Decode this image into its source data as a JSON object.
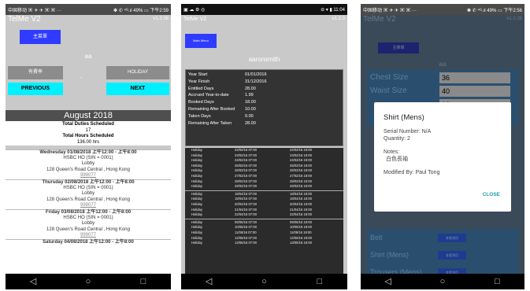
{
  "screen1": {
    "status": {
      "left": "中国移动 ▣ ✈ ✈ ▣ ▣ ···",
      "right": "✽ ✆ ⁴ᴳ.ıl 49% ▭ 下午2:59"
    },
    "app_title": "TelMe V2",
    "version": "v1.3.38",
    "main_menu": "主菜單",
    "username": "aa",
    "paid_button": "有費率",
    "separator": "-",
    "holiday_button": "HOLIDAY",
    "previous_button": "PREVIOUS",
    "next_button": "NEXT",
    "month": "August 2018",
    "total_duties_label": "Total Duties Scheduled",
    "total_duties_value": "17",
    "total_hours_label": "Total Hours Scheduled",
    "total_hours_value": "136.00 hrs",
    "entries": [
      {
        "title": "Wednesday 01/08/2018 上午12:00 - 上午8:00",
        "org": "HSBC HO (SIN = 0001)",
        "place": "Lobby",
        "address": "128 Queen's Road Central , Hong Kong",
        "code": "999077"
      },
      {
        "title": "Thursday 02/08/2018 上午12:00 - 上午8:00",
        "org": "HSBC HO (SIN = 0001)",
        "place": "Lobby",
        "address": "128 Queen's Road Central , Hong Kong",
        "code": "999077"
      },
      {
        "title": "Friday 03/08/2018 上午12:00 - 上午8:00",
        "org": "HSBC HO (SIN = 0001)",
        "place": "Lobby",
        "address": "128 Queen's Road Central , Hong Kong",
        "code": "999077"
      },
      {
        "title": "Saturday 04/08/2018 上午12:00 - 上午8:00",
        "org": "",
        "place": "",
        "address": "",
        "code": ""
      }
    ]
  },
  "screen2": {
    "status": {
      "left": "▣ ☁ ⚙ ◎",
      "right": "⊖ ▾ ▮ 11:04"
    },
    "app_title": "TelMe V2",
    "version": "v1.2.0",
    "main_menu": "Main Menu",
    "username": "aaronsmith",
    "summary": [
      {
        "label": "Year Start",
        "value": "01/01/2016"
      },
      {
        "label": "Year Finish",
        "value": "31/12/2016"
      },
      {
        "label": "Entitled Days",
        "value": "28.00"
      },
      {
        "label": "Accrued Year-to-date",
        "value": "1.99"
      },
      {
        "label": "Booked Days",
        "value": "18.00"
      },
      {
        "label": "Remaining After Booked",
        "value": "10.00"
      },
      {
        "label": "Taken Days",
        "value": "0.00"
      },
      {
        "label": "Remaining After Taken",
        "value": "28.00"
      }
    ],
    "groups": [
      [
        {
          "type": "Holiday",
          "start": "22/02/16 07:00",
          "end": "22/02/16 19:00"
        },
        {
          "type": "Holiday",
          "start": "23/02/16 07:00",
          "end": "23/02/16 19:00"
        },
        {
          "type": "Holiday",
          "start": "24/02/16 07:00",
          "end": "24/02/16 19:00"
        },
        {
          "type": "Holiday",
          "start": "25/02/16 07:00",
          "end": "25/02/16 19:00"
        },
        {
          "type": "Holiday",
          "start": "26/02/16 07:00",
          "end": "26/02/16 19:00"
        },
        {
          "type": "Holiday",
          "start": "27/02/16 07:00",
          "end": "27/02/16 19:00"
        },
        {
          "type": "Holiday",
          "start": "28/02/16 07:00",
          "end": "28/02/16 19:00"
        },
        {
          "type": "Holiday",
          "start": "29/02/16 07:00",
          "end": "29/02/16 19:00"
        }
      ],
      [
        {
          "type": "Holiday",
          "start": "18/04/16 07:00",
          "end": "18/04/16 19:00"
        },
        {
          "type": "Holiday",
          "start": "19/04/16 07:00",
          "end": "19/04/16 19:00"
        },
        {
          "type": "Holiday",
          "start": "20/04/16 07:00",
          "end": "20/04/16 19:00"
        },
        {
          "type": "Holiday",
          "start": "21/04/16 07:00",
          "end": "21/04/16 19:00"
        },
        {
          "type": "Holiday",
          "start": "22/04/16 07:00",
          "end": "22/04/16 19:00"
        }
      ],
      [
        {
          "type": "Holiday",
          "start": "09/05/16 07:00",
          "end": "09/05/16 19:00"
        },
        {
          "type": "Holiday",
          "start": "10/05/16 07:00",
          "end": "10/05/16 19:00"
        },
        {
          "type": "Holiday",
          "start": "11/05/16 07:00",
          "end": "11/05/16 19:00"
        },
        {
          "type": "Holiday",
          "start": "12/05/16 07:00",
          "end": "12/05/16 19:00"
        },
        {
          "type": "Holiday",
          "start": "13/05/16 07:00",
          "end": "13/05/16 19:00"
        }
      ]
    ]
  },
  "screen3": {
    "status": {
      "left": "中国移动 ▣ ✈ ✈ ▣ ▣ ···",
      "right": "✽ ✆ ⁴ᴳ.ıl 49% ▭ 下午2:56"
    },
    "app_title": "TelMe V2",
    "version": "v1.3.38",
    "main_menu": "主菜單",
    "username": "aa",
    "measurements": [
      {
        "label": "Chest Size",
        "value": "36"
      },
      {
        "label": "Waist Size",
        "value": "40"
      },
      {
        "label": "",
        "value": "10"
      }
    ],
    "uniform_items": [
      {
        "label": "Belt",
        "button": "查看領用"
      },
      {
        "label": "Shirt (Mens)",
        "button": "查看領用"
      },
      {
        "label": "Trousers (Mens)",
        "button": "查看領用"
      }
    ],
    "dialog": {
      "title": "Shirt (Mens)",
      "serial": "Serial Number: N/A",
      "quantity": "Quantity: 2",
      "notes_label": "Notes:",
      "notes_value": "白色長袖",
      "modified": "Modified By: Paul Tong",
      "close": "CLOSE"
    }
  },
  "nav": {
    "back": "◁",
    "home": "○",
    "recents": "□"
  },
  "colors": {
    "blue_button": "#2f3cff",
    "cyan_button": "#00f0ff",
    "dialog_accent": "#1e9ea3"
  }
}
